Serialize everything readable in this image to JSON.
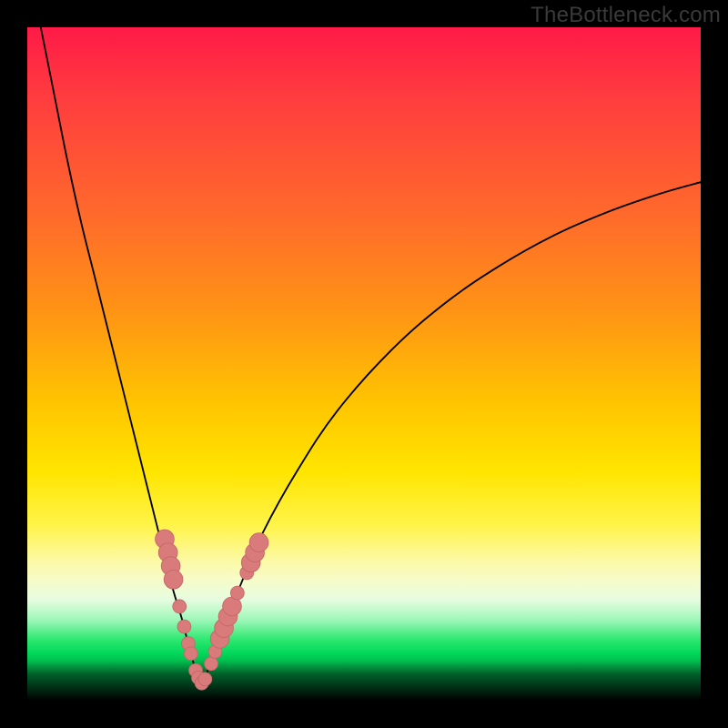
{
  "watermark": "TheBottleneck.com",
  "colors": {
    "curve": "#000000",
    "dot_fill": "#d97b7b",
    "dot_stroke": "#c56767"
  },
  "chart_data": {
    "type": "line",
    "title": "",
    "xlabel": "",
    "ylabel": "",
    "xlim": [
      0,
      100
    ],
    "ylim": [
      0,
      100
    ],
    "series": [
      {
        "name": "left-branch",
        "x": [
          2,
          4,
          6,
          8,
          10,
          12,
          14,
          16,
          18,
          20,
          21.5,
          23,
          24,
          25,
          25.8
        ],
        "y": [
          100,
          90,
          80,
          71,
          63,
          55,
          47,
          39,
          31,
          23,
          17,
          12,
          8,
          4.5,
          2
        ]
      },
      {
        "name": "right-branch",
        "x": [
          25.8,
          27,
          28.5,
          30,
          32,
          35,
          40,
          46,
          54,
          62,
          70,
          78,
          86,
          94,
          100
        ],
        "y": [
          2,
          5,
          9,
          13,
          18,
          25,
          34,
          43,
          52,
          59,
          64.5,
          69,
          72.5,
          75.3,
          77
        ]
      }
    ],
    "dots": {
      "name": "markers",
      "points": [
        {
          "x": 20.4,
          "y": 24.0,
          "r": 1.4
        },
        {
          "x": 20.9,
          "y": 22.0,
          "r": 1.4
        },
        {
          "x": 21.3,
          "y": 20.0,
          "r": 1.4
        },
        {
          "x": 21.7,
          "y": 18.0,
          "r": 1.4
        },
        {
          "x": 22.6,
          "y": 14.0,
          "r": 1.0
        },
        {
          "x": 23.3,
          "y": 11.0,
          "r": 1.0
        },
        {
          "x": 23.9,
          "y": 8.5,
          "r": 1.0
        },
        {
          "x": 24.3,
          "y": 7.0,
          "r": 1.0
        },
        {
          "x": 25.0,
          "y": 4.5,
          "r": 1.0
        },
        {
          "x": 25.4,
          "y": 3.4,
          "r": 1.0
        },
        {
          "x": 25.9,
          "y": 2.6,
          "r": 1.0
        },
        {
          "x": 26.4,
          "y": 3.2,
          "r": 1.0
        },
        {
          "x": 27.3,
          "y": 5.5,
          "r": 1.0
        },
        {
          "x": 27.9,
          "y": 7.3,
          "r": 1.0
        },
        {
          "x": 28.6,
          "y": 9.2,
          "r": 1.4
        },
        {
          "x": 29.2,
          "y": 10.8,
          "r": 1.4
        },
        {
          "x": 29.8,
          "y": 12.5,
          "r": 1.4
        },
        {
          "x": 30.4,
          "y": 14.0,
          "r": 1.4
        },
        {
          "x": 31.2,
          "y": 16.0,
          "r": 1.0
        },
        {
          "x": 32.6,
          "y": 19.0,
          "r": 1.0
        },
        {
          "x": 33.2,
          "y": 20.5,
          "r": 1.4
        },
        {
          "x": 33.8,
          "y": 22.0,
          "r": 1.4
        },
        {
          "x": 34.4,
          "y": 23.5,
          "r": 1.4
        }
      ]
    }
  }
}
